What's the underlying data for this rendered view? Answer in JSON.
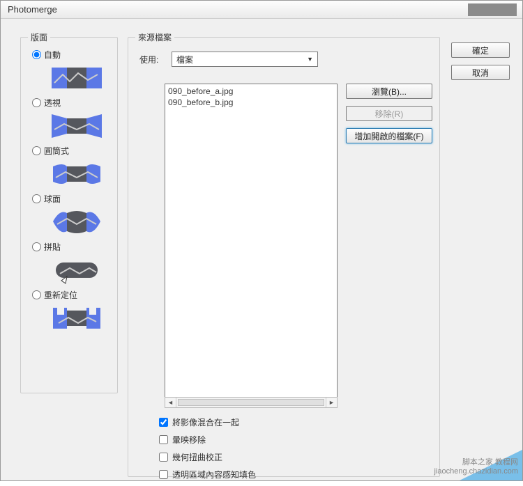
{
  "title": "Photomerge",
  "layout": {
    "legend": "版面",
    "option_auto": "自動",
    "option_perspective": "透視",
    "option_cylindrical": "圓筒式",
    "option_spherical": "球面",
    "option_collage": "拼貼",
    "option_reposition": "重新定位",
    "selected": "auto"
  },
  "source": {
    "legend": "來源檔案",
    "use_label": "使用:",
    "use_value": "檔案",
    "files": [
      "090_before_a.jpg",
      "090_before_b.jpg"
    ],
    "btn_browse": "瀏覽(B)...",
    "btn_remove": "移除(R)",
    "btn_add_open": "增加開啟的檔案(F)",
    "chk_blend": "將影像混合在一起",
    "chk_vignette": "暈映移除",
    "chk_geom": "幾何扭曲校正",
    "chk_content_fill": "透明區域內容感知填色"
  },
  "actions": {
    "ok": "確定",
    "cancel": "取消"
  },
  "watermark_line1": "脚本之家 教程网",
  "watermark_line2": "jiaocheng.chazidian.com"
}
